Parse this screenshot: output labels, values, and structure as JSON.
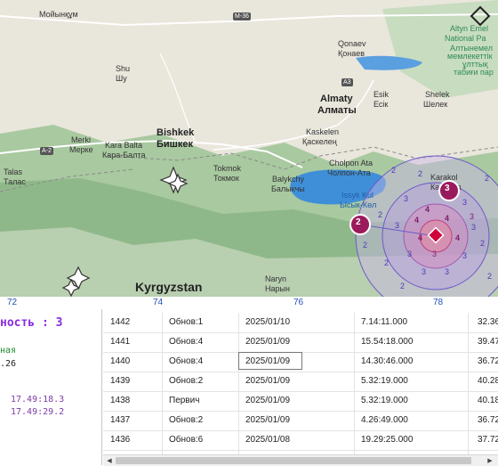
{
  "map": {
    "places": [
      {
        "id": "moyinkum",
        "text": "Мойынқұм"
      },
      {
        "id": "shu-lat",
        "text": "Shu"
      },
      {
        "id": "shu-cyr",
        "text": "Шу"
      },
      {
        "id": "merki-lat",
        "text": "Merki"
      },
      {
        "id": "merki-cyr",
        "text": "Мерке"
      },
      {
        "id": "karabalta-lat",
        "text": "Kara Balta"
      },
      {
        "id": "karabalta-cyr",
        "text": "Кара-Балта"
      },
      {
        "id": "bishkek-lat",
        "text": "Bishkek"
      },
      {
        "id": "bishkek-cyr",
        "text": "Бишкек"
      },
      {
        "id": "tokmok-lat",
        "text": "Tokmok"
      },
      {
        "id": "tokmok-cyr",
        "text": "Токмок"
      },
      {
        "id": "talas-lat",
        "text": "Talas"
      },
      {
        "id": "talas-cyr",
        "text": "Талас"
      },
      {
        "id": "balykchy-lat",
        "text": "Balykchy"
      },
      {
        "id": "balykchy-cyr",
        "text": "Балыкчы"
      },
      {
        "id": "almaty-lat",
        "text": "Almaty"
      },
      {
        "id": "almaty-cyr",
        "text": "Алматы"
      },
      {
        "id": "kaskelen-lat",
        "text": "Kaskelen"
      },
      {
        "id": "kaskelen-cyr",
        "text": "Қаскелең"
      },
      {
        "id": "qonaev-lat",
        "text": "Qonaev"
      },
      {
        "id": "qonaev-cyr",
        "text": "Қонаев"
      },
      {
        "id": "esik-lat",
        "text": "Esik"
      },
      {
        "id": "esik-cyr",
        "text": "Есік"
      },
      {
        "id": "shelek-lat",
        "text": "Shelek"
      },
      {
        "id": "shelek-cyr",
        "text": "Шелек"
      },
      {
        "id": "cholponata-lat",
        "text": "Cholpon Ata"
      },
      {
        "id": "cholponata-cyr",
        "text": "Чолпон-Ата"
      },
      {
        "id": "karakol-lat",
        "text": "Karakol"
      },
      {
        "id": "karakol-cyr",
        "text": "Каракол"
      },
      {
        "id": "naryn-lat",
        "text": "Naryn"
      },
      {
        "id": "naryn-cyr",
        "text": "Нарын"
      }
    ],
    "water": {
      "issykkul_lat": "Issyk Kul",
      "issykkul_cyr": "Ысык-Көл"
    },
    "park": {
      "l1": "Altyn Emel",
      "l2": "National Pa",
      "l3": "Алтынемел",
      "l4": "мемлекеттік",
      "l5": "ұлттық",
      "l6": "табиғи пар"
    },
    "country": "Kyrgyzstan",
    "roads": {
      "m36": "M-36",
      "a2": "A-2",
      "a3": "A3"
    },
    "markers": {
      "m1": "2",
      "m2": "3"
    },
    "contour_labels": [
      "2",
      "2",
      "2",
      "2",
      "2",
      "2",
      "3",
      "3",
      "3",
      "3",
      "3",
      "3",
      "3",
      "3",
      "4",
      "4",
      "4",
      "4",
      "4",
      "3",
      "3",
      "3",
      "2",
      "2",
      "2"
    ]
  },
  "axis": {
    "ticks": [
      "72",
      "74",
      "76",
      "78"
    ]
  },
  "left_panel": {
    "heading": "ность : 3",
    "green": "ная",
    "num": ".26",
    "time1": "17.49:18.3",
    "time2": "17.49:29.2"
  },
  "table": {
    "rows": [
      {
        "id": "1442",
        "type": "Обнов:1",
        "date": "2025/01/10",
        "time": "7.14:11.000",
        "val": "32.36"
      },
      {
        "id": "1441",
        "type": "Обнов:4",
        "date": "2025/01/09",
        "time": "15.54:18.000",
        "val": "39.47"
      },
      {
        "id": "1440",
        "type": "Обнов:4",
        "date": "2025/01/09",
        "time": "14.30:46.000",
        "val": "36.72"
      },
      {
        "id": "1439",
        "type": "Обнов:2",
        "date": "2025/01/09",
        "time": "5.32:19.000",
        "val": "40.28"
      },
      {
        "id": "1438",
        "type": "Первич",
        "date": "2025/01/09",
        "time": "5.32:19.000",
        "val": "40.18"
      },
      {
        "id": "1437",
        "type": "Обнов:2",
        "date": "2025/01/09",
        "time": "4.26:49.000",
        "val": "36.72"
      },
      {
        "id": "1436",
        "type": "Обнов:6",
        "date": "2025/01/08",
        "time": "19.29:25.000",
        "val": "37.72"
      }
    ]
  },
  "colors": {
    "epicenter": "#d0003a",
    "marker": "#9b1a5c",
    "axis": "#1f4fb8",
    "heading": "#8a2be2"
  }
}
